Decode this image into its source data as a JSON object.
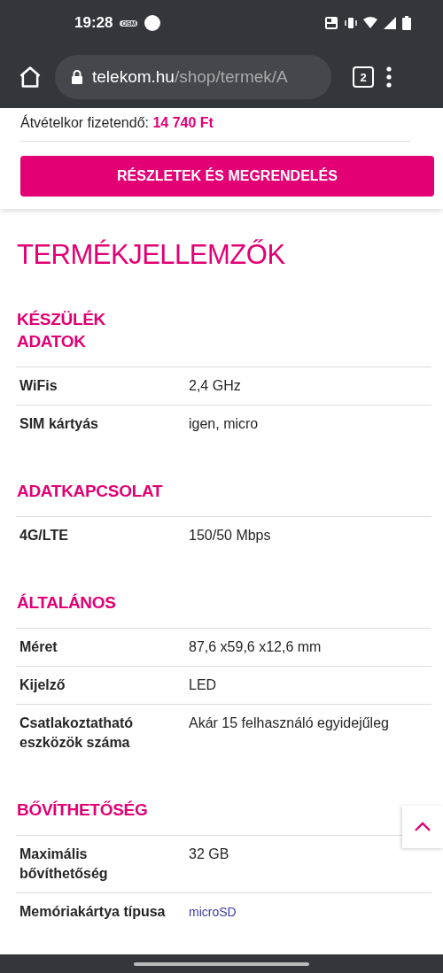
{
  "status_bar": {
    "time": "19:28",
    "carrier_badge": "OSM"
  },
  "browser": {
    "url_host": "telekom.hu",
    "url_path": "/shop/termek/A",
    "tab_count": "2"
  },
  "order_card": {
    "label": "Átvételkor fizetendő:",
    "price": "14 740 Ft",
    "button": "RÉSZLETEK ÉS MEGRENDELÉS"
  },
  "title": "TERMÉKJELLEMZŐK",
  "sections": [
    {
      "heading": "KÉSZÜLÉK\nADATOK",
      "rows": [
        {
          "label": "WiFis",
          "value": "2,4 GHz",
          "kind": "text"
        },
        {
          "label": "SIM kártyás",
          "value": "igen, micro",
          "kind": "text"
        }
      ]
    },
    {
      "heading": "ADATKAPCSOLAT",
      "rows": [
        {
          "label": "4G/LTE",
          "value": "150/50 Mbps",
          "kind": "text"
        }
      ]
    },
    {
      "heading": "ÁLTALÁNOS",
      "rows": [
        {
          "label": "Méret",
          "value": "87,6 x59,6 x12,6 mm",
          "kind": "text"
        },
        {
          "label": "Kijelző",
          "value": "LED",
          "kind": "text"
        },
        {
          "label": "Csatlakoztatható eszközök száma",
          "value": "Akár 15 felhasználó egyidejűleg",
          "kind": "text"
        }
      ]
    },
    {
      "heading": "BŐVÍTHETŐSÉG",
      "rows": [
        {
          "label": "Maximális bővíthetőség",
          "value": "32 GB",
          "kind": "text"
        },
        {
          "label": "Memóriakártya típusa",
          "value": "microSD",
          "kind": "link"
        }
      ]
    }
  ]
}
